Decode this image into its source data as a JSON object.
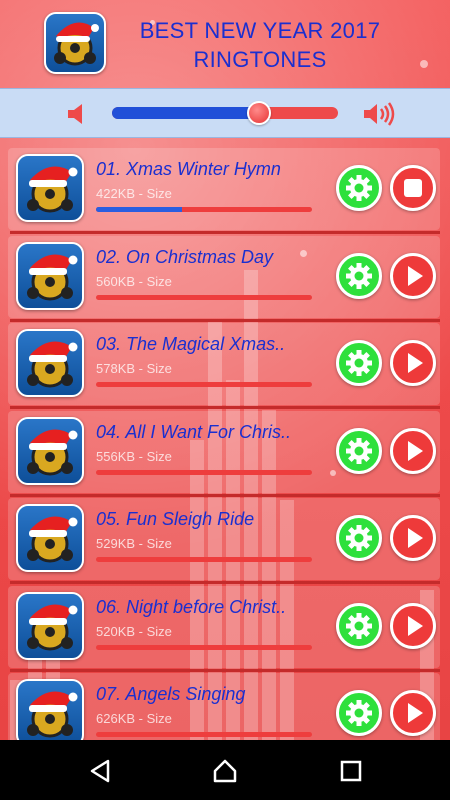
{
  "app": {
    "title": "BEST NEW YEAR 2017 RINGTONES"
  },
  "volume": {
    "level": 0.65,
    "low_icon": "volume-low-icon",
    "high_icon": "volume-high-icon"
  },
  "songs": [
    {
      "title": "01. Xmas Winter Hymn",
      "size": "422KB - Size",
      "progress": 0.4,
      "state": "playing"
    },
    {
      "title": "02. On Christmas Day",
      "size": "560KB - Size",
      "progress": 0,
      "state": "stopped"
    },
    {
      "title": "03. The Magical Xmas..",
      "size": "578KB - Size",
      "progress": 0,
      "state": "stopped"
    },
    {
      "title": "04.  All I Want For Chris..",
      "size": "556KB - Size",
      "progress": 0,
      "state": "stopped"
    },
    {
      "title": "05. Fun Sleigh Ride",
      "size": "529KB - Size",
      "progress": 0,
      "state": "stopped"
    },
    {
      "title": "06. Night before Christ..",
      "size": "520KB - Size",
      "progress": 0,
      "state": "stopped"
    },
    {
      "title": "07. Angels Singing",
      "size": "626KB - Size",
      "progress": 0,
      "state": "stopped"
    }
  ],
  "icons": {
    "settings": "gear-icon",
    "play": "play-icon",
    "stop": "stop-icon"
  },
  "nav": {
    "back": "back-icon",
    "home": "home-icon",
    "recents": "recents-icon"
  },
  "colors": {
    "accent_blue": "#1a2fd0",
    "background_red": "#ee4a4a",
    "settings_green": "#2ee03c"
  }
}
